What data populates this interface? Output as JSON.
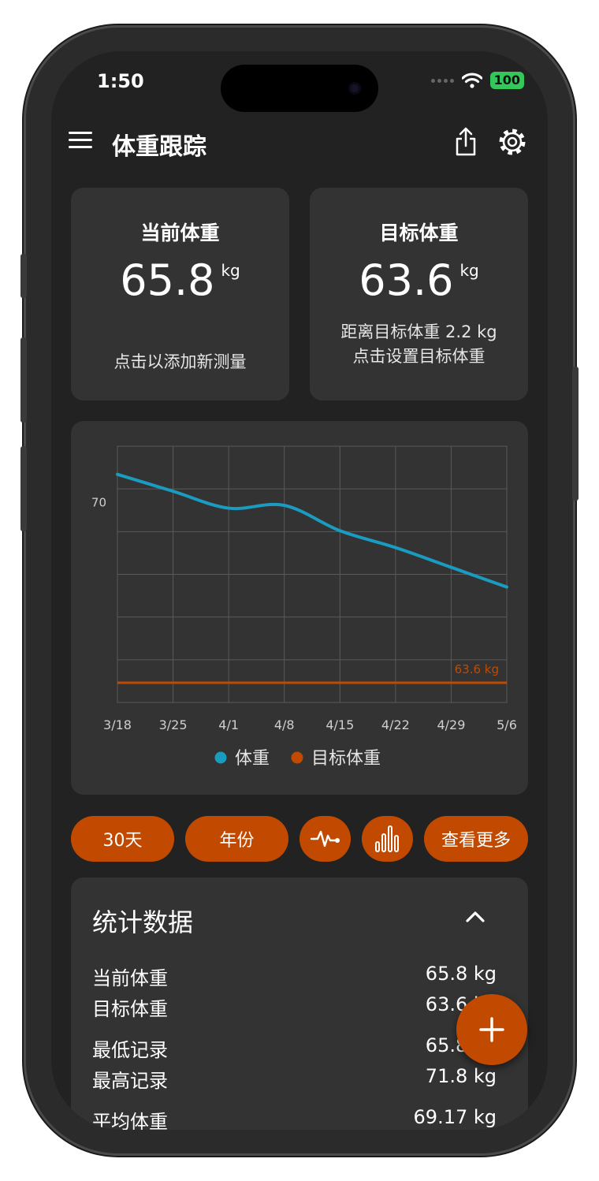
{
  "status_bar": {
    "time": "1:50",
    "battery": "100"
  },
  "app_bar": {
    "title": "体重跟踪"
  },
  "current_card": {
    "label": "当前体重",
    "value": "65.8",
    "unit": "kg",
    "hint": "点击以添加新测量"
  },
  "target_card": {
    "label": "目标体重",
    "value": "63.6",
    "unit": "kg",
    "distance": "距离目标体重 2.2 kg",
    "hint": "点击设置目标体重"
  },
  "chart_data": {
    "type": "line",
    "x": [
      "3/18",
      "3/25",
      "4/1",
      "4/8",
      "4/15",
      "4/22",
      "4/29",
      "5/6"
    ],
    "y_ticks": [
      "70"
    ],
    "series": [
      {
        "name": "体重",
        "color": "#1a9bc0",
        "values": [
          71.0,
          70.4,
          69.8,
          69.9,
          69.0,
          68.4,
          67.7,
          67.0
        ]
      },
      {
        "name": "目标体重",
        "color": "#c24a00",
        "values": [
          63.6,
          63.6,
          63.6,
          63.6,
          63.6,
          63.6,
          63.6,
          63.6
        ]
      }
    ],
    "target_label": "63.6 kg",
    "ylim": [
      62.9,
      72.0
    ],
    "grid": true,
    "legend": "bottom-center"
  },
  "range_buttons": [
    {
      "label": "30天"
    },
    {
      "label": "年份"
    },
    {
      "icon": "pulse-icon"
    },
    {
      "icon": "bar-chart-icon"
    },
    {
      "label": "查看更多"
    }
  ],
  "stats": {
    "title": "统计数据",
    "rows": [
      {
        "label": "当前体重",
        "value": "65.8 kg"
      },
      {
        "label": "目标体重",
        "value": "63.6 kg"
      },
      {
        "label": "最低记录",
        "value": "65.8 kg"
      },
      {
        "label": "最高记录",
        "value": "71.8 kg"
      },
      {
        "label": "平均体重",
        "value": "69.17 kg"
      }
    ]
  },
  "colors": {
    "accent": "#c24a00",
    "series_weight": "#1a9bc0",
    "card": "#333333",
    "background": "#222222"
  }
}
